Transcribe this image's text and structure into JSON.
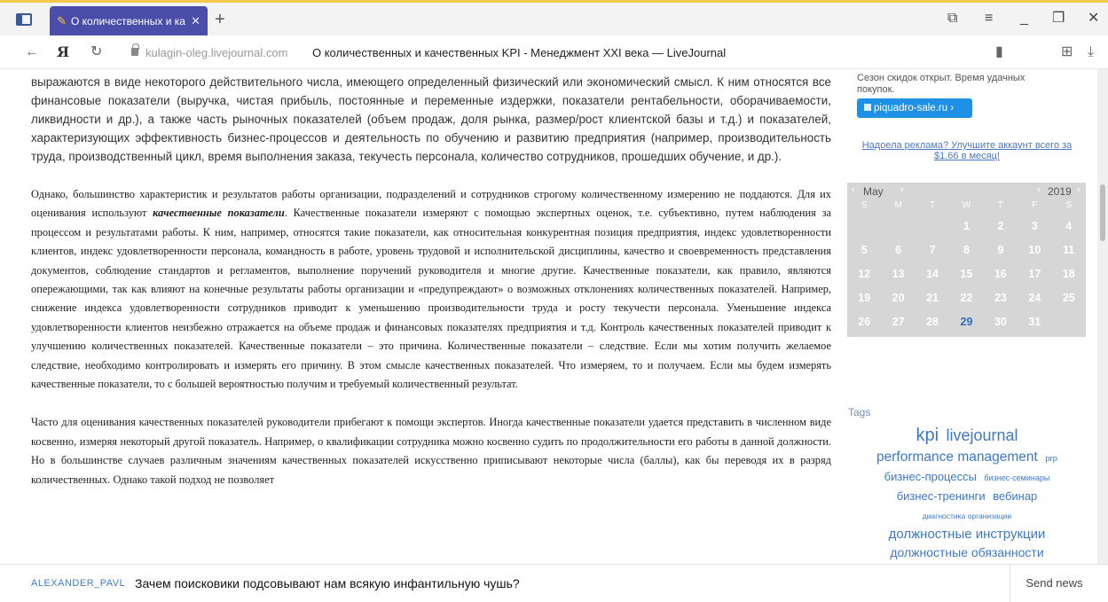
{
  "browser": {
    "tab_title": "О количественных и ка",
    "domain": "kulagin-oleg.livejournal.com",
    "page_title": "О количественных и качественных KPI - Менеджмент XXI века — LiveJournal",
    "yandex_label": "Я"
  },
  "article": {
    "p1": "выражаются в виде некоторого действительного числа, имеющего определенный физический или экономический смысл. К ним относятся все финансовые показатели (выручка, чистая прибыль, постоянные и переменные издержки, показатели рентабельности, оборачиваемости, ликвидности и др.), а также часть рыночных показателей (объем продаж, доля рынка, размер/рост клиентской базы и т.д.) и показателей, характеризующих эффективность бизнес-процессов и деятельность по обучению и развитию предприятия (например, производительность труда, производственный цикл, время выполнения заказа, текучесть персонала, количество сотрудников, прошедших обучение, и др.).",
    "p2_before": "Однако, большинство характеристик и результатов работы организации, подразделений и сотрудников строгому количественному измерению не поддаются. Для их оценивания используют ",
    "p2_emph": "качественные показатели",
    "p2_after": ". Качественные показатели измеряют с помощью экспертных оценок, т.е. субъективно, путем наблюдения за процессом и результатами работы. К ним, например, относятся такие показатели, как относительная конкурентная позиция предприятия, индекс удовлетворенности клиентов, индекс удовлетворенности персонала, командность в работе, уровень трудовой и исполнительской дисциплины, качество и своевременность представления документов, соблюдение стандартов и регламентов, выполнение поручений руководителя и многие другие. Качественные показатели, как правило, являются опережающими, так как влияют на конечные результаты работы организации и «предупреждают» о возможных отклонениях количественных показателей. Например, снижение индекса удовлетворенности сотрудников приводит к уменьшению производительности труда и росту текучести персонала. Уменьшение индекса удовлетворенности клиентов неизбежно отражается на объеме продаж и финансовых показателях предприятия и т.д. Контроль качественных показателей приводит к улучшению количественных показателей. Качественные показатели – это причина. Количественные показатели – следствие. Если мы хотим получить желаемое следствие, необходимо контролировать и измерять его причину. В этом смысле качественных показателей. Что измеряем, то и получаем. Если мы будем измерять качественные показатели, то с большей вероятностью получим и требуемый количественный результат.",
    "p3": "Часто для оценивания качественных показателей руководители прибегают к помощи экспертов. Иногда качественные показатели удается представить в численном виде косвенно, измеряя некоторый другой показатель. Например, о квалификации сотрудника можно косвенно судить по продолжительности его работы в данной должности. Но в большинстве случаев различным значениям качественных показателей искусственно приписывают некоторые числа (баллы), как бы переводя их в разряд количественных. Однако такой подход не позволяет"
  },
  "sidebar": {
    "ad_text": "Сезон скидок открыт. Время удачных покупок.",
    "ad_button": "piquadro-sale.ru ›",
    "upgrade_text": "Надоела реклама? Улучшите аккаунт всего за $1.66 в месяц!",
    "calendar": {
      "month": "May",
      "year": "2019",
      "dows": [
        "S",
        "M",
        "T",
        "W",
        "T",
        "F",
        "S"
      ],
      "weeks": [
        [
          "",
          "",
          "",
          "1",
          "2",
          "3",
          "4"
        ],
        [
          "5",
          "6",
          "7",
          "8",
          "9",
          "10",
          "11"
        ],
        [
          "12",
          "13",
          "14",
          "15",
          "16",
          "17",
          "18"
        ],
        [
          "19",
          "20",
          "21",
          "22",
          "23",
          "24",
          "25"
        ],
        [
          "26",
          "27",
          "28",
          "29",
          "30",
          "31",
          ""
        ]
      ],
      "today": "29"
    },
    "tags_title": "Tags",
    "tags": [
      {
        "label": "kpi",
        "size": 20
      },
      {
        "label": "livejournal",
        "size": 18
      },
      {
        "label": "performance management",
        "size": 15.5
      },
      {
        "label": "prp",
        "size": 9.5
      },
      {
        "label": "бизнес-процессы",
        "size": 13
      },
      {
        "label": "бизнес-семинары",
        "size": 9
      },
      {
        "label": "бизнес-тренинги",
        "size": 13
      },
      {
        "label": "вебинар",
        "size": 13
      },
      {
        "label": "диагностика организации",
        "size": 8.5
      },
      {
        "label": "должностные инструкции",
        "size": 15
      },
      {
        "label": "должностные обязанности",
        "size": 14
      }
    ]
  },
  "bottom": {
    "user": "ALEXANDER_PAVL",
    "headline": "Зачем поисковики подсовывают нам всякую инфантильную чушь?",
    "send_news": "Send news"
  }
}
